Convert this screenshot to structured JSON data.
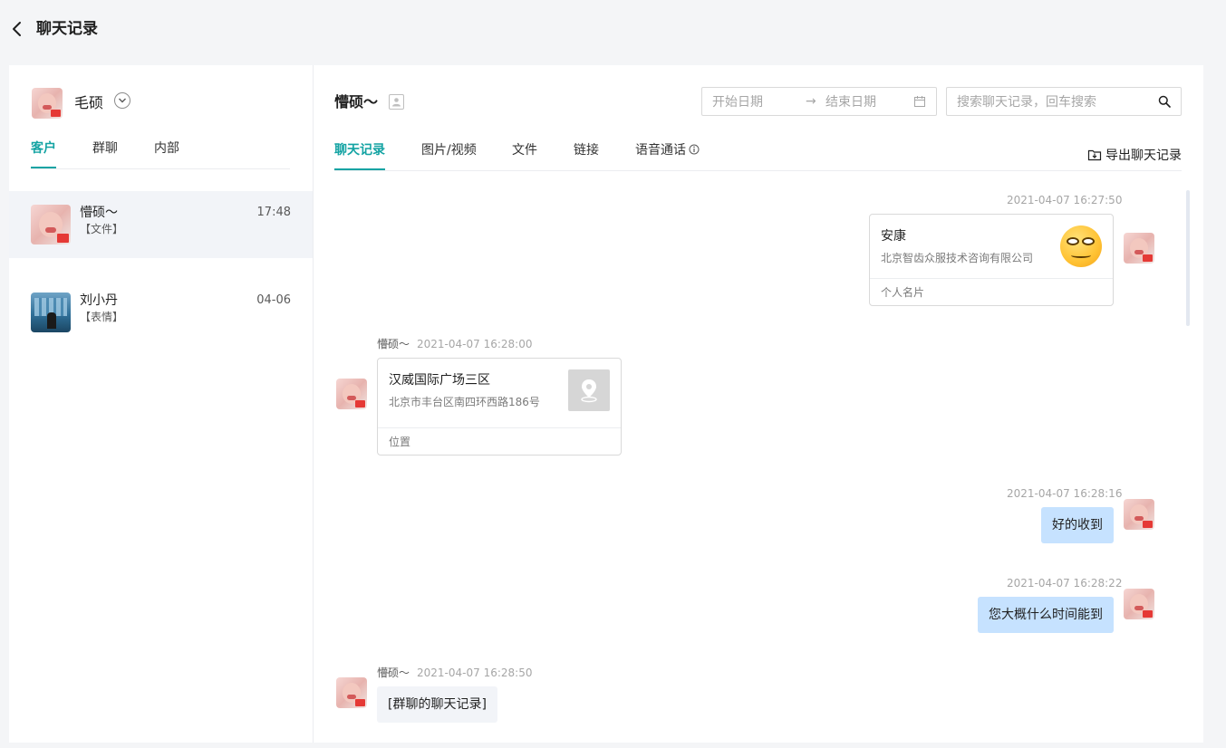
{
  "page": {
    "title": "聊天记录"
  },
  "owner": {
    "name": "毛硕"
  },
  "left_tabs": [
    {
      "label": "客户",
      "active": true
    },
    {
      "label": "群聊",
      "active": false
    },
    {
      "label": "内部",
      "active": false
    }
  ],
  "conversations": [
    {
      "name": "懵硕～",
      "preview": "【文件】",
      "time": "17:48",
      "active": true
    },
    {
      "name": "刘小丹",
      "preview": "【表情】",
      "time": "04-06",
      "active": false
    }
  ],
  "chat": {
    "title": "懵硕～",
    "date_start_placeholder": "开始日期",
    "date_end_placeholder": "结束日期",
    "date_arrow": "→",
    "search_placeholder": "搜索聊天记录，回车搜索",
    "export_label": "导出聊天记录",
    "tabs": [
      {
        "label": "聊天记录",
        "active": true
      },
      {
        "label": "图片/视频",
        "active": false
      },
      {
        "label": "文件",
        "active": false
      },
      {
        "label": "链接",
        "active": false
      },
      {
        "label": "语音通话",
        "active": false
      }
    ]
  },
  "messages": {
    "m1": {
      "time": "2021-04-07 16:27:50",
      "card_name": "安康",
      "card_company": "北京智齿众服技术咨询有限公司",
      "card_type": "个人名片"
    },
    "m2": {
      "sender": "懵硕～",
      "time": "2021-04-07 16:28:00",
      "place": "汉威国际广场三区",
      "address": "北京市丰台区南四环西路186号",
      "card_type": "位置"
    },
    "m3": {
      "time": "2021-04-07 16:28:16",
      "text": "好的收到"
    },
    "m4": {
      "time": "2021-04-07 16:28:22",
      "text": "您大概什么时间能到"
    },
    "m5": {
      "sender": "懵硕～",
      "time": "2021-04-07 16:28:50",
      "text": "[群聊的聊天记录]"
    }
  },
  "colors": {
    "accent": "#13a3a3",
    "bubble_out": "#c6e2ff",
    "bubble_in": "#f2f4f8"
  }
}
